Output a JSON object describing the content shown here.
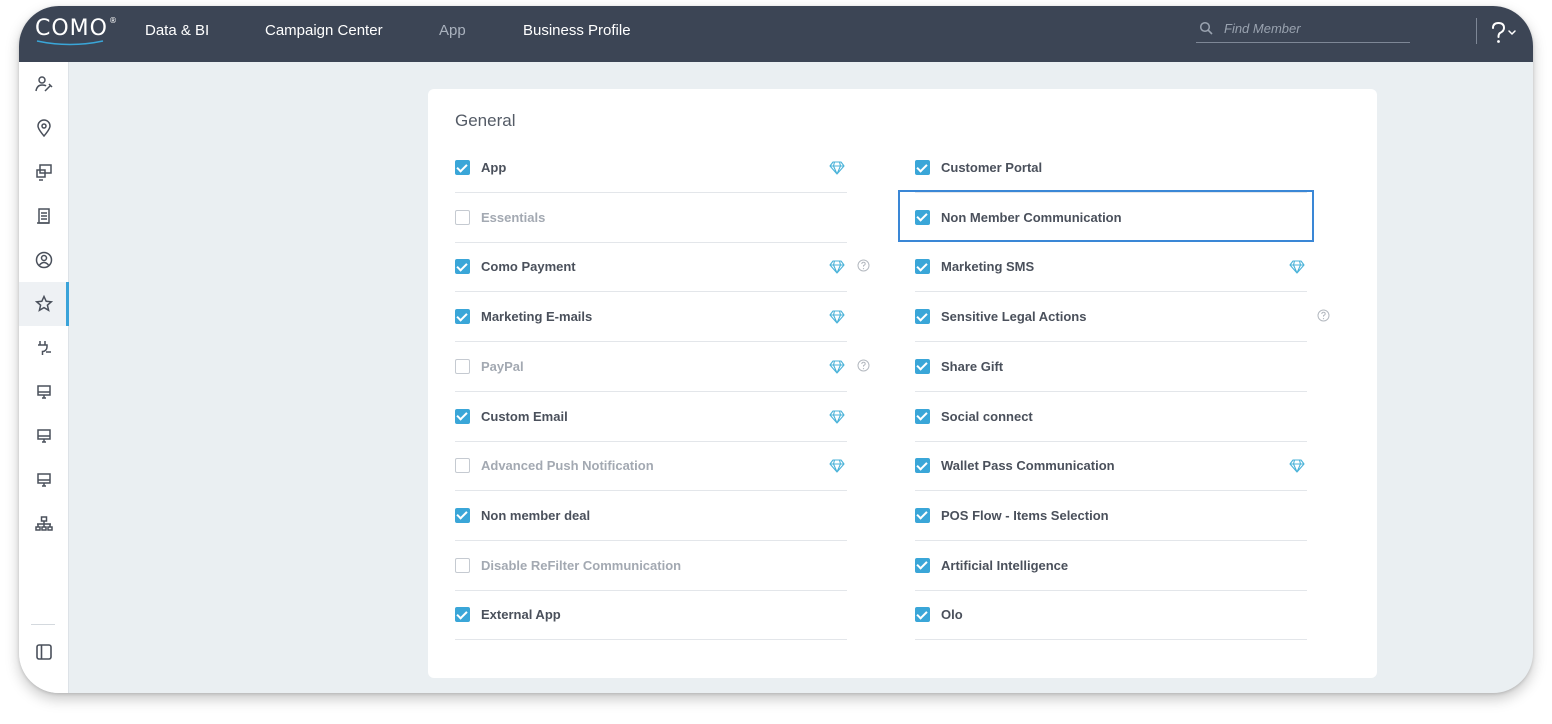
{
  "brand": {
    "name": "COMO",
    "mark": "®"
  },
  "nav": [
    {
      "label": "Data & BI",
      "active": false
    },
    {
      "label": "Campaign Center",
      "active": false
    },
    {
      "label": "App",
      "active": false,
      "muted": true
    },
    {
      "label": "Business Profile",
      "active": false
    }
  ],
  "search": {
    "placeholder": "Find Member",
    "value": ""
  },
  "help": {
    "icon": "question-icon"
  },
  "sidebar": {
    "items": [
      {
        "icon": "members-edit-icon",
        "active": false
      },
      {
        "icon": "location-pin-icon",
        "active": false
      },
      {
        "icon": "screens-icon",
        "active": false
      },
      {
        "icon": "receipt-icon",
        "active": false
      },
      {
        "icon": "user-circle-icon",
        "active": false
      },
      {
        "icon": "star-settings-icon",
        "active": true
      },
      {
        "icon": "plug-icon",
        "active": false
      },
      {
        "icon": "monitor-icon",
        "active": false
      },
      {
        "icon": "monitor-icon",
        "active": false
      },
      {
        "icon": "monitor-icon",
        "active": false
      },
      {
        "icon": "hierarchy-icon",
        "active": false
      }
    ],
    "footer_icon": "panel-toggle-icon"
  },
  "section": {
    "title": "General",
    "left": [
      {
        "label": "App",
        "checked": true,
        "premium": true,
        "help": false
      },
      {
        "label": "Essentials",
        "checked": false,
        "premium": false,
        "help": false
      },
      {
        "label": "Como Payment",
        "checked": true,
        "premium": true,
        "help": true
      },
      {
        "label": "Marketing E-mails",
        "checked": true,
        "premium": true,
        "help": false
      },
      {
        "label": "PayPal",
        "checked": false,
        "premium": true,
        "help": true
      },
      {
        "label": "Custom Email",
        "checked": true,
        "premium": true,
        "help": false
      },
      {
        "label": "Advanced Push Notification",
        "checked": false,
        "premium": true,
        "help": false
      },
      {
        "label": "Non member deal",
        "checked": true,
        "premium": false,
        "help": false
      },
      {
        "label": "Disable ReFilter Communication",
        "checked": false,
        "premium": false,
        "help": false
      },
      {
        "label": "External App",
        "checked": true,
        "premium": false,
        "help": false
      }
    ],
    "right": [
      {
        "label": "Customer Portal",
        "checked": true,
        "premium": false,
        "help": false
      },
      {
        "label": "Non Member Communication",
        "checked": true,
        "premium": false,
        "help": false,
        "highlighted": true
      },
      {
        "label": "Marketing SMS",
        "checked": true,
        "premium": true,
        "help": false
      },
      {
        "label": "Sensitive Legal Actions",
        "checked": true,
        "premium": false,
        "help": true
      },
      {
        "label": "Share Gift",
        "checked": true,
        "premium": false,
        "help": false
      },
      {
        "label": "Social connect",
        "checked": true,
        "premium": false,
        "help": false
      },
      {
        "label": "Wallet Pass Communication",
        "checked": true,
        "premium": true,
        "help": false
      },
      {
        "label": "POS Flow - Items Selection",
        "checked": true,
        "premium": false,
        "help": false
      },
      {
        "label": "Artificial Intelligence",
        "checked": true,
        "premium": false,
        "help": false
      },
      {
        "label": "Olo",
        "checked": true,
        "premium": false,
        "help": false
      }
    ]
  },
  "colors": {
    "topbar": "#3c4555",
    "accent": "#3aa6d8",
    "highlight": "#3a87d6",
    "premium": "#4bb3d9"
  }
}
